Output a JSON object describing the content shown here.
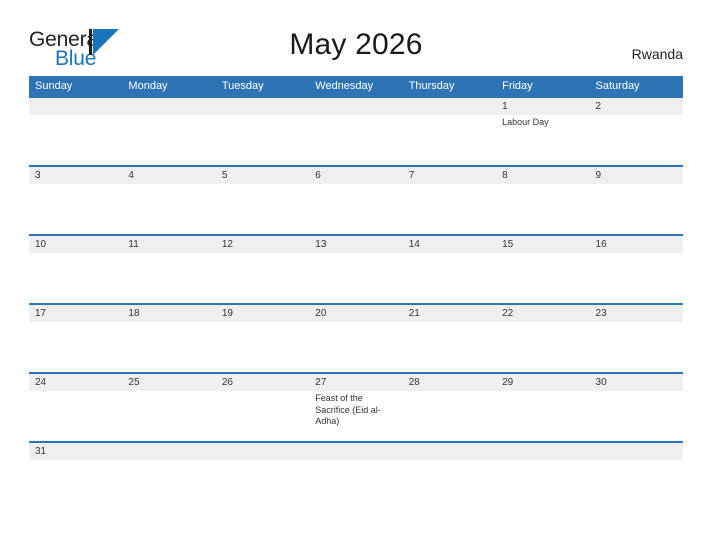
{
  "brand": {
    "name_part1": "General",
    "name_part2": "Blue",
    "flag_color": "#1b75bb",
    "text_color": "#231f20"
  },
  "header": {
    "title": "May 2026",
    "country": "Rwanda"
  },
  "colors": {
    "header_blue": "#2e74b5",
    "date_strip": "#efefef",
    "rule_blue": "#2e74b5",
    "text": "#333333"
  },
  "calendar": {
    "day_headers": [
      "Sunday",
      "Monday",
      "Tuesday",
      "Wednesday",
      "Thursday",
      "Friday",
      "Saturday"
    ],
    "weeks": [
      {
        "dates": [
          "",
          "",
          "",
          "",
          "",
          "1",
          "2"
        ],
        "events": [
          "",
          "",
          "",
          "",
          "",
          "Labour Day",
          ""
        ]
      },
      {
        "dates": [
          "3",
          "4",
          "5",
          "6",
          "7",
          "8",
          "9"
        ],
        "events": [
          "",
          "",
          "",
          "",
          "",
          "",
          ""
        ]
      },
      {
        "dates": [
          "10",
          "11",
          "12",
          "13",
          "14",
          "15",
          "16"
        ],
        "events": [
          "",
          "",
          "",
          "",
          "",
          "",
          ""
        ]
      },
      {
        "dates": [
          "17",
          "18",
          "19",
          "20",
          "21",
          "22",
          "23"
        ],
        "events": [
          "",
          "",
          "",
          "",
          "",
          "",
          ""
        ]
      },
      {
        "dates": [
          "24",
          "25",
          "26",
          "27",
          "28",
          "29",
          "30"
        ],
        "events": [
          "",
          "",
          "",
          "Feast of the Sacrifice (Eid al-Adha)",
          "",
          "",
          ""
        ]
      },
      {
        "dates": [
          "31",
          "",
          "",
          "",
          "",
          "",
          ""
        ],
        "events": [
          "",
          "",
          "",
          "",
          "",
          "",
          ""
        ]
      }
    ]
  }
}
